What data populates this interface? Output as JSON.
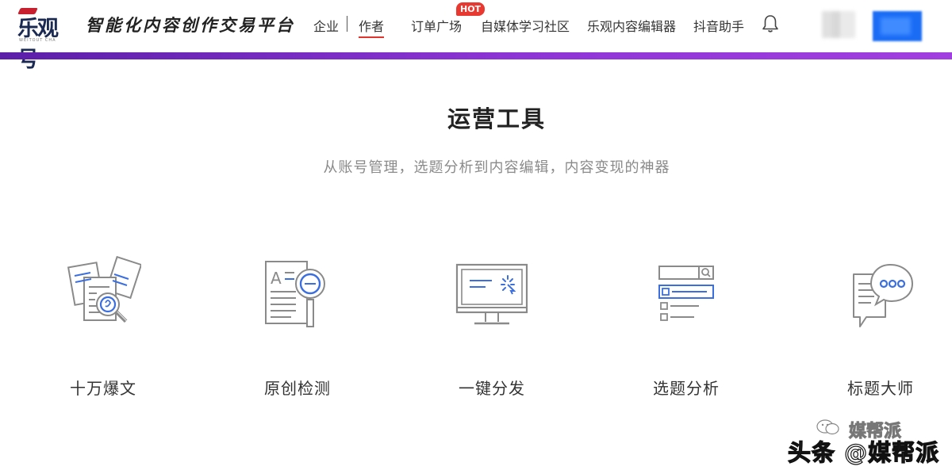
{
  "brand": {
    "logo_text": "乐观号",
    "logo_sub": "WEITOUT CHA",
    "slogan": "智能化内容创作交易平台"
  },
  "nav": {
    "items": [
      {
        "label": "企业"
      },
      {
        "label": "作者"
      },
      {
        "label": "订单广场"
      },
      {
        "label": "自媒体学习社区"
      },
      {
        "label": "乐观内容编辑器"
      },
      {
        "label": "抖音助手"
      }
    ],
    "active": "作者",
    "hot_badge": "HOT",
    "accent_color": "#e0342e"
  },
  "colors": {
    "header_gradient_start": "#5b1fa8",
    "header_gradient_end": "#a23fe0",
    "icon_blue": "#3b6fe0",
    "icon_gray": "#8a8a8a"
  },
  "section": {
    "title": "运营工具",
    "subtitle": "从账号管理，选题分析到内容编辑，内容变现的神器"
  },
  "tools": [
    {
      "label": "十万爆文",
      "icon": "documents-search-icon"
    },
    {
      "label": "原创检测",
      "icon": "document-magnifier-icon"
    },
    {
      "label": "一键分发",
      "icon": "monitor-publish-icon"
    },
    {
      "label": "选题分析",
      "icon": "search-list-icon"
    },
    {
      "label": "标题大师",
      "icon": "chat-bubbles-icon"
    }
  ],
  "watermark": {
    "small": "媒帮派",
    "big": "头条 @媒帮派"
  }
}
